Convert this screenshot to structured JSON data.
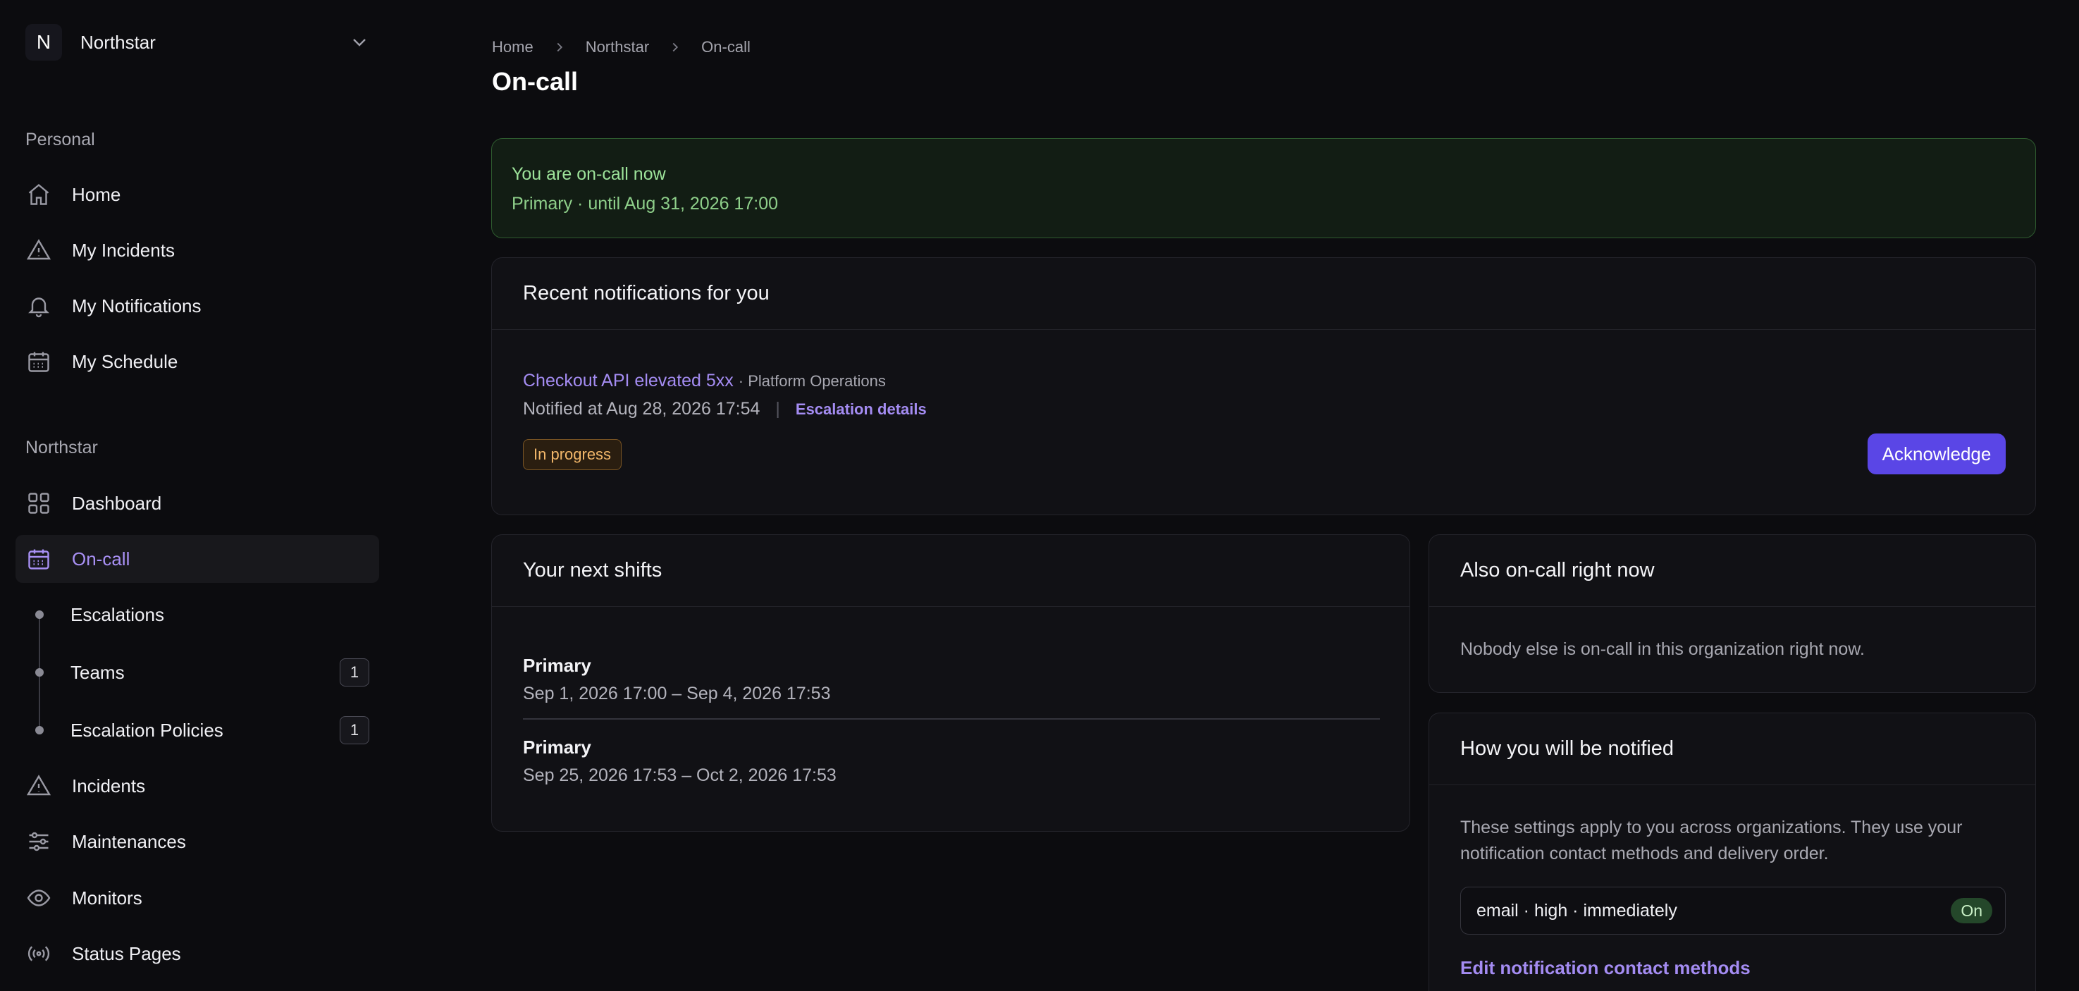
{
  "org": {
    "initial": "N",
    "name": "Northstar"
  },
  "sidebar": {
    "personal_label": "Personal",
    "personal_items": [
      {
        "label": "Home",
        "icon": "home-icon"
      },
      {
        "label": "My Incidents",
        "icon": "alert-triangle-icon"
      },
      {
        "label": "My Notifications",
        "icon": "bell-icon"
      },
      {
        "label": "My Schedule",
        "icon": "calendar-icon"
      }
    ],
    "org_label": "Northstar",
    "org_items": [
      {
        "label": "Dashboard",
        "icon": "grid-icon"
      },
      {
        "label": "On-call",
        "icon": "calendar-icon",
        "active": true
      }
    ],
    "sub_items": [
      {
        "label": "Escalations",
        "count": ""
      },
      {
        "label": "Teams",
        "count": "1"
      },
      {
        "label": "Escalation Policies",
        "count": "1"
      }
    ],
    "more_items": [
      {
        "label": "Incidents",
        "icon": "alert-triangle-icon"
      },
      {
        "label": "Maintenances",
        "icon": "sliders-icon"
      },
      {
        "label": "Monitors",
        "icon": "eye-icon"
      },
      {
        "label": "Status Pages",
        "icon": "broadcast-icon"
      }
    ]
  },
  "breadcrumb": [
    "Home",
    "Northstar",
    "On-call"
  ],
  "page_title": "On-call",
  "banner": {
    "line1": "You are on-call now",
    "line2": "Primary · until Aug 31, 2026 17:00"
  },
  "notifications": {
    "title": "Recent notifications for you",
    "item": {
      "incident": "Checkout API elevated 5xx",
      "team": "· Platform Operations",
      "notified_at": "Notified at Aug 28, 2026 17:54",
      "separator": "|",
      "escalation_link": "Escalation details",
      "status": "In progress",
      "ack_label": "Acknowledge"
    }
  },
  "shifts": {
    "title": "Your next shifts",
    "items": [
      {
        "role": "Primary",
        "range": "Sep 1, 2026 17:00 – Sep 4, 2026 17:53"
      },
      {
        "role": "Primary",
        "range": "Sep 25, 2026 17:53 – Oct 2, 2026 17:53"
      }
    ]
  },
  "also_oncall": {
    "title": "Also on-call right now",
    "empty": "Nobody else is on-call in this organization right now."
  },
  "how_notified": {
    "title": "How you will be notified",
    "description": "These settings apply to you across organizations. They use your notification contact methods and delivery order.",
    "method": "email · high · immediately",
    "method_state": "On",
    "edit_link": "Edit notification contact methods"
  },
  "colors": {
    "accent": "#a48cf2",
    "primary_button": "#5a46e6",
    "success_text": "#9de39a",
    "warning_text": "#f2b76a"
  }
}
